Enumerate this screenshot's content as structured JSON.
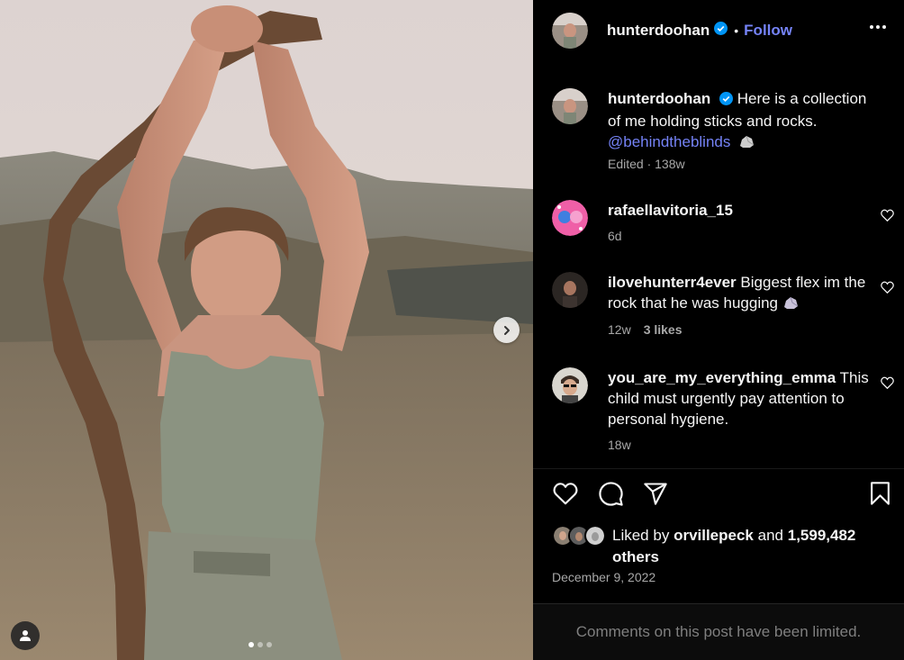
{
  "post": {
    "author": "hunterdoohan",
    "follow_label": "Follow",
    "separator": "•",
    "carousel": {
      "count": 3,
      "active": 1
    }
  },
  "caption": {
    "username": "hunterdoohan",
    "text": "Here is a collection of me holding sticks and rocks.",
    "mention": "@behindtheblinds",
    "meta": "Edited · 138w"
  },
  "comments": [
    {
      "username": "rafaellavitoria_15",
      "text": "",
      "time": "6d",
      "likes": ""
    },
    {
      "username": "ilovehunterr4ever",
      "text": "Biggest flex im the rock that he was hugging",
      "time": "12w",
      "likes": "3 likes"
    },
    {
      "username": "you_are_my_everything_emma",
      "text": "This child must urgently pay attention to personal hygiene.",
      "time": "18w",
      "likes": ""
    }
  ],
  "likes": {
    "prefix": "Liked by",
    "user": "orvillepeck",
    "and": "and",
    "count": "1,599,482 others"
  },
  "date": "December 9, 2022",
  "limited_notice": "Comments on this post have been limited.",
  "colors": {
    "link": "#7583f7",
    "verified": "#0095f6",
    "muted": "#a8a8a8",
    "background": "#000000"
  },
  "icons": [
    "verified-badge-icon",
    "more-options-icon",
    "heart-icon",
    "comment-icon",
    "share-icon",
    "bookmark-icon",
    "chevron-right-icon",
    "tag-user-icon",
    "rock-emoji-icon"
  ]
}
